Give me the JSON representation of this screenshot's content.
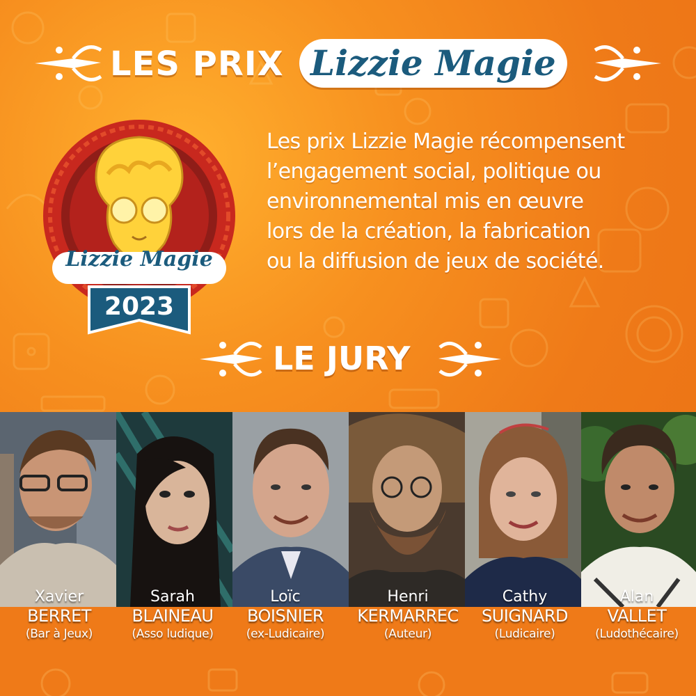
{
  "header": {
    "title_prefix": "LES PRIX",
    "title_script": "Lizzie Magie"
  },
  "badge": {
    "name": "Lizzie Magie",
    "year": "2023"
  },
  "description": {
    "lines": [
      "Les prix Lizzie Magie récompensent",
      "l’engagement social, politique ou",
      "environnemental mis en œuvre",
      "lors de la création, la fabrication",
      "ou la diffusion de jeux de société."
    ]
  },
  "jury": {
    "title": "LE JURY",
    "members": [
      {
        "first": "Xavier",
        "last": "BERRET",
        "role": "(Bar à Jeux)"
      },
      {
        "first": "Sarah",
        "last": "BLAINEAU",
        "role": "(Asso ludique)"
      },
      {
        "first": "Loïc",
        "last": "BOISNIER",
        "role": "(ex-Ludicaire)"
      },
      {
        "first": "Henri",
        "last": "KERMARREC",
        "role": "(Auteur)"
      },
      {
        "first": "Cathy",
        "last": "SUIGNARD",
        "role": "(Ludicaire)"
      },
      {
        "first": "Alan",
        "last": "VALLET",
        "role": "(Ludothécaire)"
      }
    ]
  },
  "colors": {
    "background": "#ef7a18",
    "accent_blue": "#1b5b7d",
    "badge_red": "#c8281e",
    "text": "#ffffff"
  }
}
